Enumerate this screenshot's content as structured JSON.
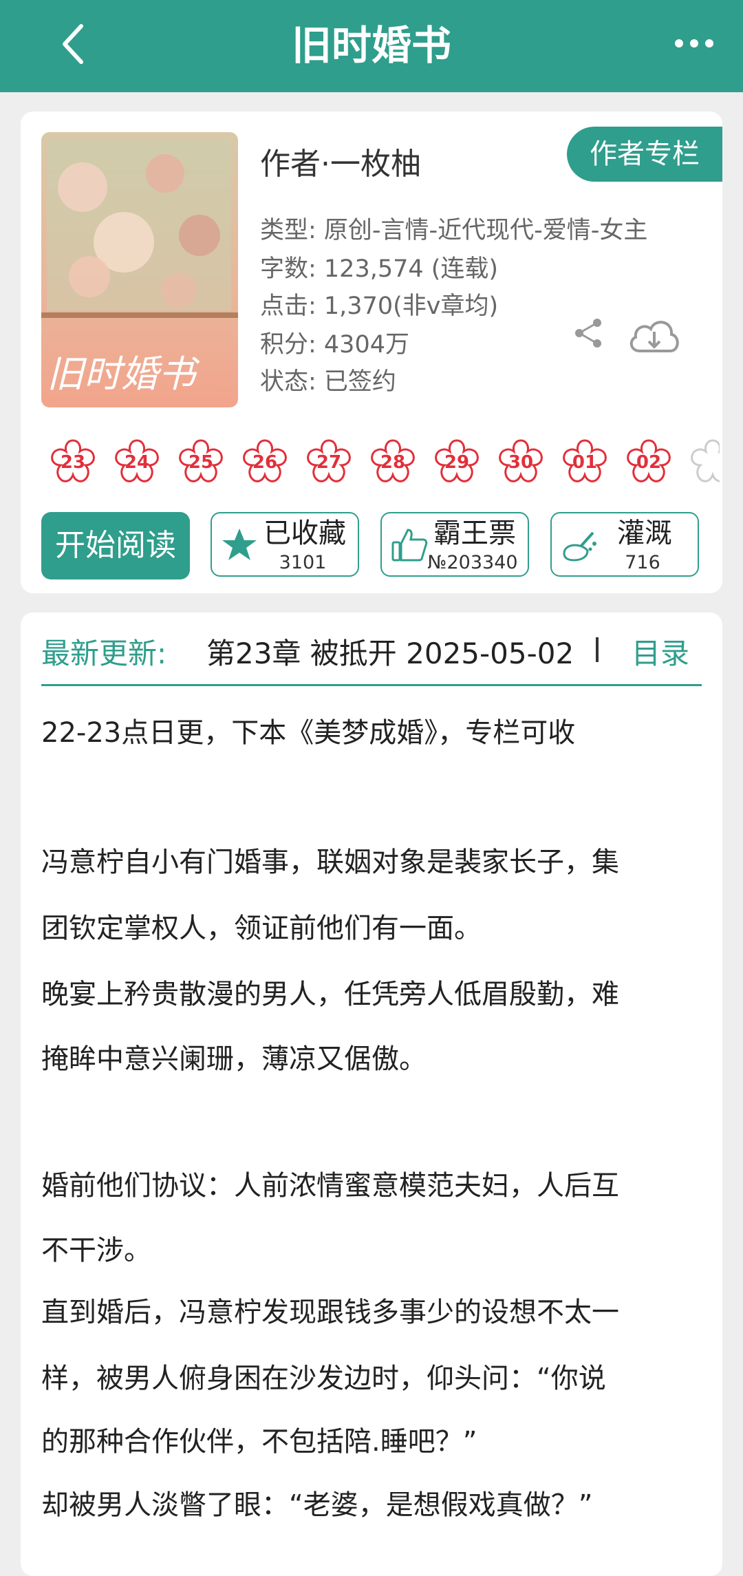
{
  "header": {
    "title": "旧时婚书"
  },
  "book": {
    "author": "作者·一枚柚",
    "author_column_label": "作者专栏",
    "cover_title_text": "旧时婚书",
    "meta": {
      "type": "类型: 原创-言情-近代现代-爱情-女主",
      "words": "字数: 123,574 (连载)",
      "clicks": "点击: 1,370(非v章均)",
      "score": "积分: 4304万",
      "status": "状态: 已签约"
    }
  },
  "chapters": [
    "23",
    "24",
    "25",
    "26",
    "27",
    "28",
    "29",
    "30",
    "01",
    "02"
  ],
  "actions": {
    "read": "开始阅读",
    "fav": {
      "label": "已收藏",
      "count": "3101"
    },
    "ticket": {
      "label": "霸王票",
      "count": "№203340"
    },
    "water": {
      "label": "灌溉",
      "count": "716"
    }
  },
  "latest": {
    "label": "最新更新:",
    "text": "第23章  被抵开  2025-05-02",
    "toc": "目录"
  },
  "intro": [
    "22-23点日更，下本《美梦成婚》，专栏可收",
    "冯意柠自小有门婚事，联姻对象是裴家长子，集",
    "团钦定掌权人，领证前他们有一面。",
    "晚宴上矜贵散漫的男人，任凭旁人低眉殷勤，难",
    "掩眸中意兴阑珊，薄凉又倨傲。",
    "婚前他们协议：人前浓情蜜意模范夫妇，人后互",
    "不干涉。",
    "直到婚后，冯意柠发现跟钱多事少的设想不太一",
    "样，被男人俯身困在沙发边时，仰头问：“你说",
    "的那种合作伙伴，不包括陪.睡吧？”",
    "却被男人淡瞥了眼：“老婆，是想假戏真做？”"
  ],
  "colors": {
    "accent": "#2f9e8c",
    "chapter_red": "#e22f3a"
  }
}
